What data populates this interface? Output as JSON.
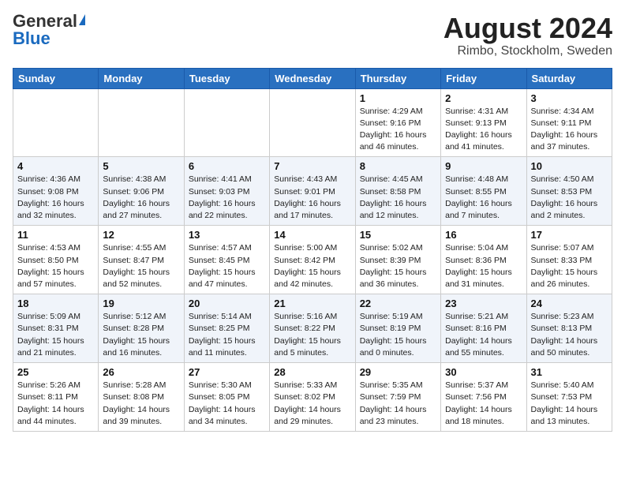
{
  "header": {
    "logo_general": "General",
    "logo_blue": "Blue",
    "month_year": "August 2024",
    "location": "Rimbo, Stockholm, Sweden"
  },
  "columns": [
    "Sunday",
    "Monday",
    "Tuesday",
    "Wednesday",
    "Thursday",
    "Friday",
    "Saturday"
  ],
  "weeks": [
    [
      {
        "day": "",
        "info": ""
      },
      {
        "day": "",
        "info": ""
      },
      {
        "day": "",
        "info": ""
      },
      {
        "day": "",
        "info": ""
      },
      {
        "day": "1",
        "info": "Sunrise: 4:29 AM\nSunset: 9:16 PM\nDaylight: 16 hours\nand 46 minutes."
      },
      {
        "day": "2",
        "info": "Sunrise: 4:31 AM\nSunset: 9:13 PM\nDaylight: 16 hours\nand 41 minutes."
      },
      {
        "day": "3",
        "info": "Sunrise: 4:34 AM\nSunset: 9:11 PM\nDaylight: 16 hours\nand 37 minutes."
      }
    ],
    [
      {
        "day": "4",
        "info": "Sunrise: 4:36 AM\nSunset: 9:08 PM\nDaylight: 16 hours\nand 32 minutes."
      },
      {
        "day": "5",
        "info": "Sunrise: 4:38 AM\nSunset: 9:06 PM\nDaylight: 16 hours\nand 27 minutes."
      },
      {
        "day": "6",
        "info": "Sunrise: 4:41 AM\nSunset: 9:03 PM\nDaylight: 16 hours\nand 22 minutes."
      },
      {
        "day": "7",
        "info": "Sunrise: 4:43 AM\nSunset: 9:01 PM\nDaylight: 16 hours\nand 17 minutes."
      },
      {
        "day": "8",
        "info": "Sunrise: 4:45 AM\nSunset: 8:58 PM\nDaylight: 16 hours\nand 12 minutes."
      },
      {
        "day": "9",
        "info": "Sunrise: 4:48 AM\nSunset: 8:55 PM\nDaylight: 16 hours\nand 7 minutes."
      },
      {
        "day": "10",
        "info": "Sunrise: 4:50 AM\nSunset: 8:53 PM\nDaylight: 16 hours\nand 2 minutes."
      }
    ],
    [
      {
        "day": "11",
        "info": "Sunrise: 4:53 AM\nSunset: 8:50 PM\nDaylight: 15 hours\nand 57 minutes."
      },
      {
        "day": "12",
        "info": "Sunrise: 4:55 AM\nSunset: 8:47 PM\nDaylight: 15 hours\nand 52 minutes."
      },
      {
        "day": "13",
        "info": "Sunrise: 4:57 AM\nSunset: 8:45 PM\nDaylight: 15 hours\nand 47 minutes."
      },
      {
        "day": "14",
        "info": "Sunrise: 5:00 AM\nSunset: 8:42 PM\nDaylight: 15 hours\nand 42 minutes."
      },
      {
        "day": "15",
        "info": "Sunrise: 5:02 AM\nSunset: 8:39 PM\nDaylight: 15 hours\nand 36 minutes."
      },
      {
        "day": "16",
        "info": "Sunrise: 5:04 AM\nSunset: 8:36 PM\nDaylight: 15 hours\nand 31 minutes."
      },
      {
        "day": "17",
        "info": "Sunrise: 5:07 AM\nSunset: 8:33 PM\nDaylight: 15 hours\nand 26 minutes."
      }
    ],
    [
      {
        "day": "18",
        "info": "Sunrise: 5:09 AM\nSunset: 8:31 PM\nDaylight: 15 hours\nand 21 minutes."
      },
      {
        "day": "19",
        "info": "Sunrise: 5:12 AM\nSunset: 8:28 PM\nDaylight: 15 hours\nand 16 minutes."
      },
      {
        "day": "20",
        "info": "Sunrise: 5:14 AM\nSunset: 8:25 PM\nDaylight: 15 hours\nand 11 minutes."
      },
      {
        "day": "21",
        "info": "Sunrise: 5:16 AM\nSunset: 8:22 PM\nDaylight: 15 hours\nand 5 minutes."
      },
      {
        "day": "22",
        "info": "Sunrise: 5:19 AM\nSunset: 8:19 PM\nDaylight: 15 hours\nand 0 minutes."
      },
      {
        "day": "23",
        "info": "Sunrise: 5:21 AM\nSunset: 8:16 PM\nDaylight: 14 hours\nand 55 minutes."
      },
      {
        "day": "24",
        "info": "Sunrise: 5:23 AM\nSunset: 8:13 PM\nDaylight: 14 hours\nand 50 minutes."
      }
    ],
    [
      {
        "day": "25",
        "info": "Sunrise: 5:26 AM\nSunset: 8:11 PM\nDaylight: 14 hours\nand 44 minutes."
      },
      {
        "day": "26",
        "info": "Sunrise: 5:28 AM\nSunset: 8:08 PM\nDaylight: 14 hours\nand 39 minutes."
      },
      {
        "day": "27",
        "info": "Sunrise: 5:30 AM\nSunset: 8:05 PM\nDaylight: 14 hours\nand 34 minutes."
      },
      {
        "day": "28",
        "info": "Sunrise: 5:33 AM\nSunset: 8:02 PM\nDaylight: 14 hours\nand 29 minutes."
      },
      {
        "day": "29",
        "info": "Sunrise: 5:35 AM\nSunset: 7:59 PM\nDaylight: 14 hours\nand 23 minutes."
      },
      {
        "day": "30",
        "info": "Sunrise: 5:37 AM\nSunset: 7:56 PM\nDaylight: 14 hours\nand 18 minutes."
      },
      {
        "day": "31",
        "info": "Sunrise: 5:40 AM\nSunset: 7:53 PM\nDaylight: 14 hours\nand 13 minutes."
      }
    ]
  ]
}
